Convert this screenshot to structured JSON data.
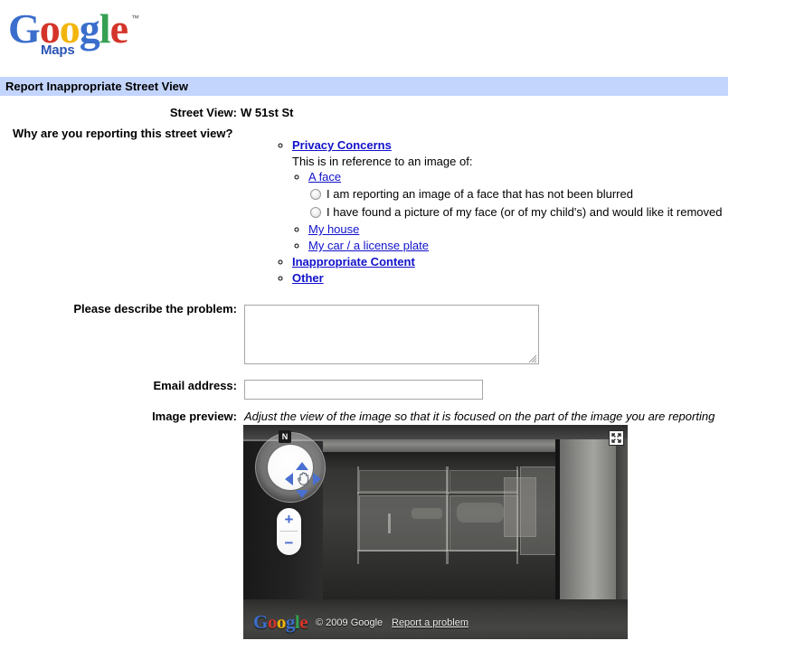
{
  "logo": {
    "letters": [
      "G",
      "o",
      "o",
      "g",
      "l",
      "e"
    ],
    "trademark": "™",
    "product": "Maps"
  },
  "header": {
    "title": "Report Inappropriate Street View",
    "bar_color": "#c3d5fd"
  },
  "street_view": {
    "label": "Street View:",
    "value": "W 51st St"
  },
  "question": "Why are you reporting this street view?",
  "reasons": {
    "privacy": {
      "label": "Privacy Concerns",
      "reference_text": "This is in reference to an image of:",
      "sub": [
        {
          "label": "A face"
        },
        {
          "label": "My house"
        },
        {
          "label": "My car / a license plate"
        }
      ],
      "face_options": [
        {
          "label": "I am reporting an image of a face that has not been blurred",
          "selected": false
        },
        {
          "label": "I have found a picture of my face (or of my child's) and would like it removed",
          "selected": false
        }
      ]
    },
    "inappropriate": {
      "label": "Inappropriate Content"
    },
    "other": {
      "label": "Other"
    }
  },
  "form": {
    "describe_label": "Please describe the problem:",
    "describe_value": "",
    "describe_placeholder": "",
    "email_label": "Email address:",
    "email_value": "",
    "email_placeholder": "",
    "preview_label": "Image preview:",
    "preview_hint": "Adjust the view of the image so that it is focused on the part of the image you are reporting"
  },
  "viewer": {
    "compass_north": "N",
    "zoom_in": "+",
    "zoom_out": "−",
    "pan_hand_icon": "✋",
    "fullscreen_icon": "expand-icon",
    "copyright": "© 2009 Google",
    "report_link": "Report a problem",
    "watermark_letters": [
      "G",
      "o",
      "o",
      "g",
      "l",
      "e"
    ]
  },
  "colors": {
    "link": "#1111cc",
    "header_blue": "#c3d5fd",
    "google_blue": "#3b6ecc",
    "google_red": "#d4342a",
    "google_yellow": "#f2b50b",
    "google_green": "#36a052",
    "maps_blue": "#2a55b5",
    "arrow_blue": "#4a6fd0"
  }
}
